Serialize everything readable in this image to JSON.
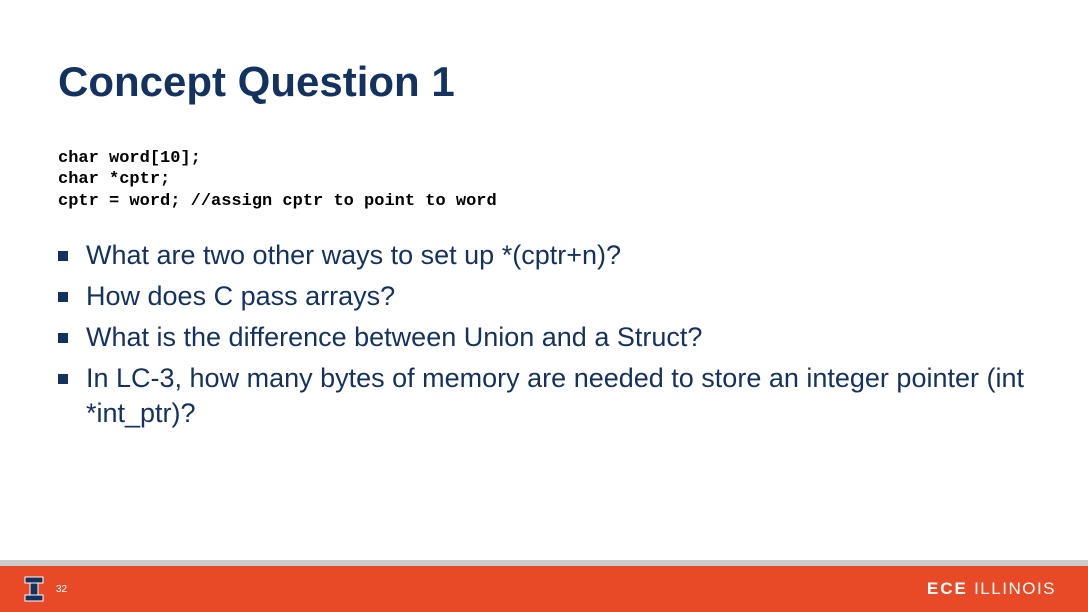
{
  "title": "Concept Question 1",
  "code": {
    "line1": "char word[10];",
    "line2": "char *cptr;",
    "line3": "cptr = word; //assign cptr to point to word"
  },
  "bullets": {
    "b1": "What are two other ways to set up *(cptr+n)?",
    "b2": "How does C pass arrays?",
    "b3": "What is the difference between Union and a Struct?",
    "b4": "In LC-3, how many bytes of memory are needed to store an integer pointer (int *int_ptr)?"
  },
  "footer": {
    "page": "32",
    "brand_bold": "ECE",
    "brand_rest": " ILLINOIS"
  },
  "colors": {
    "title": "#14325f",
    "accent": "#e84a27"
  }
}
